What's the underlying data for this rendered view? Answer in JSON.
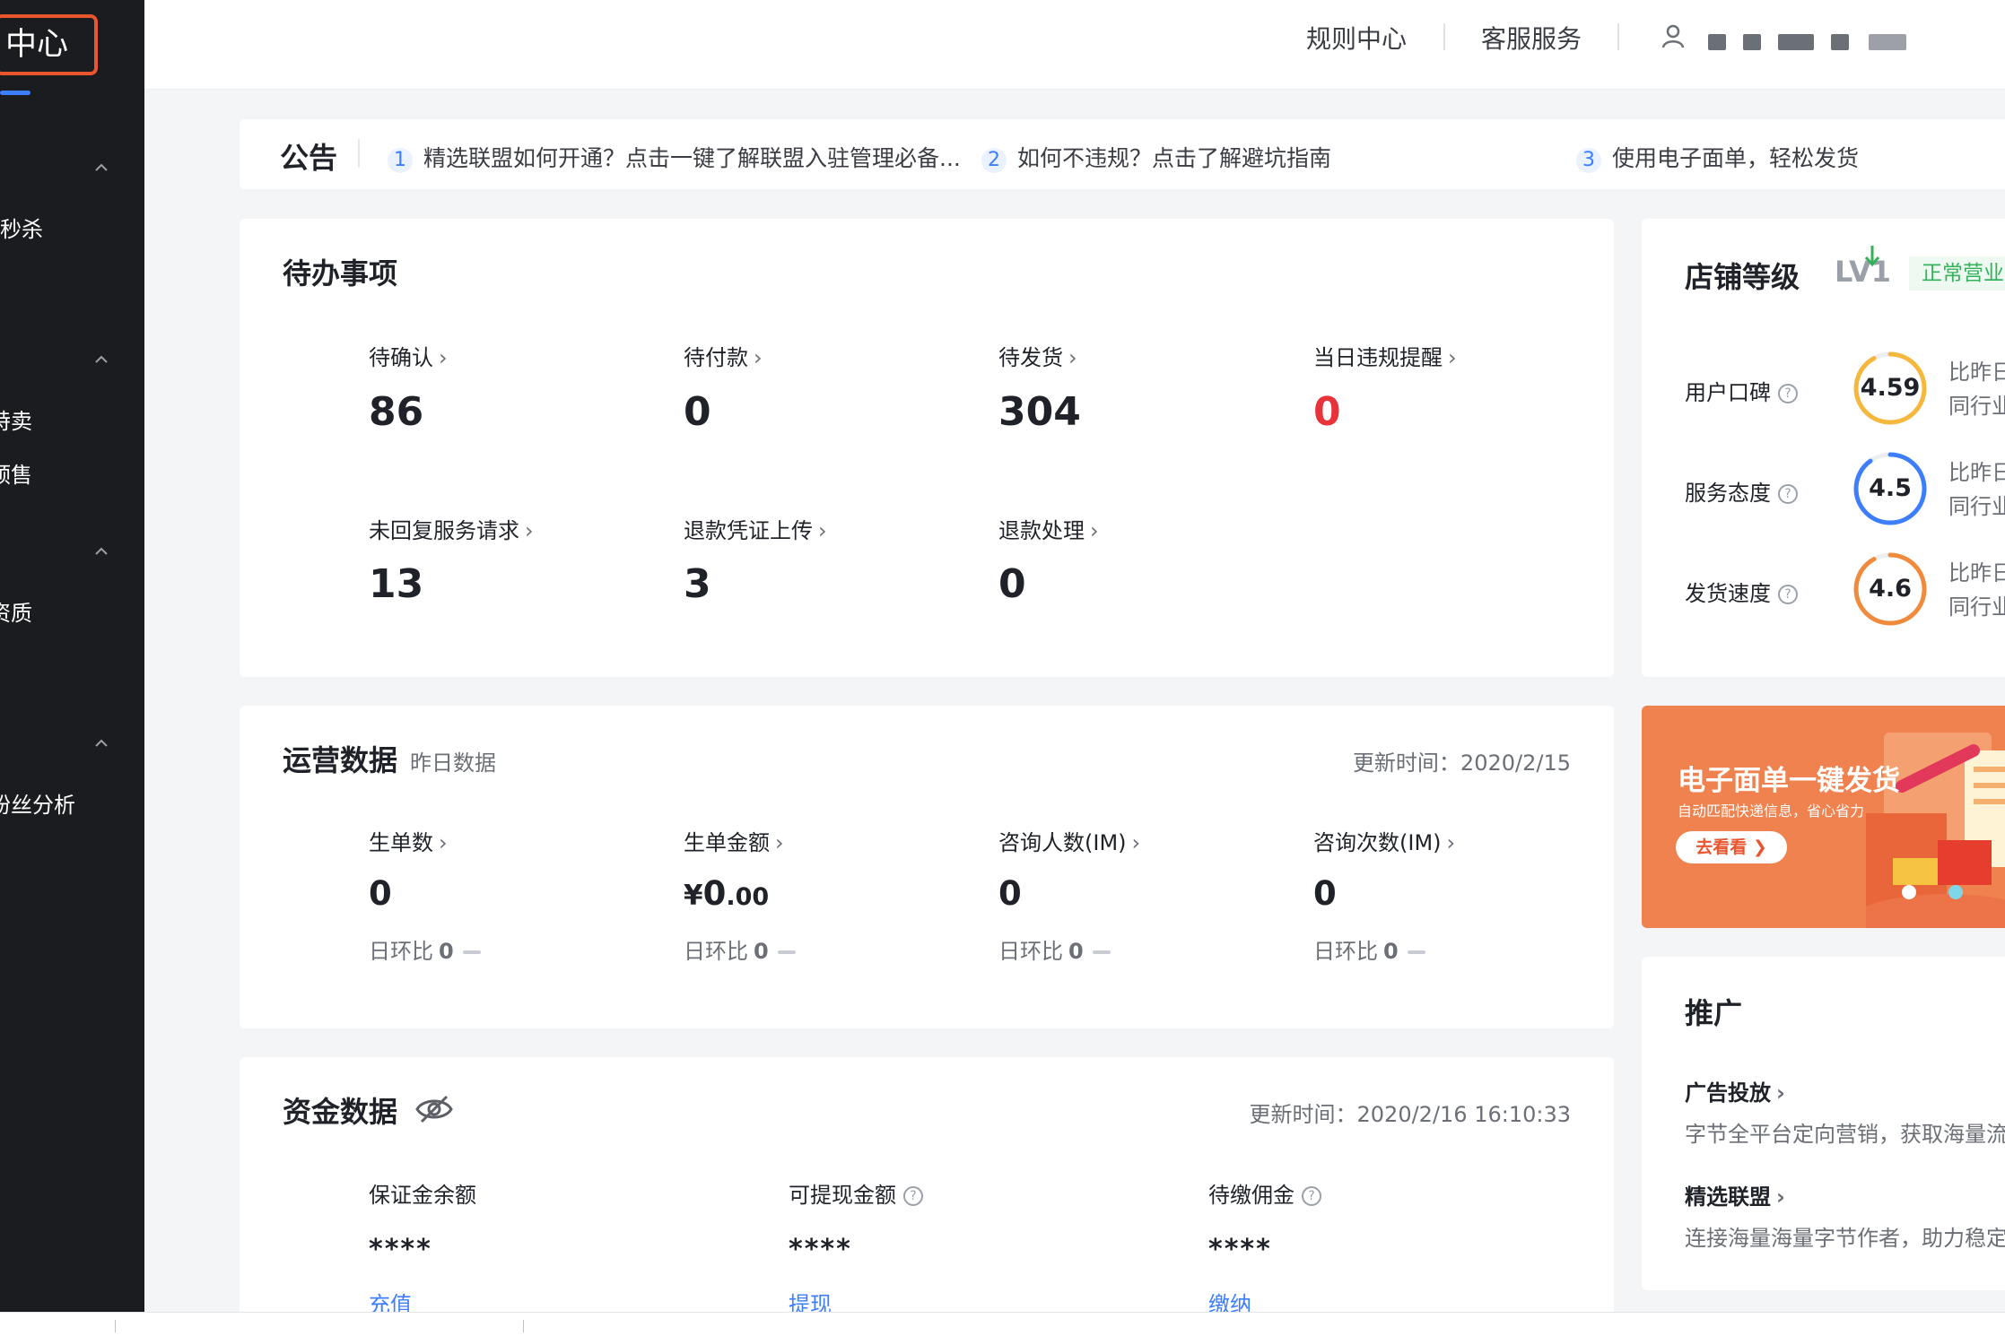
{
  "sidebar": {
    "brand": "中心",
    "items": [
      {
        "label": "秒杀"
      },
      {
        "label": "特卖"
      },
      {
        "label": "预售"
      },
      {
        "label": "资质"
      },
      {
        "label": "粉丝分析"
      }
    ]
  },
  "header": {
    "links": [
      "规则中心",
      "客服服务"
    ]
  },
  "notice": {
    "title": "公告",
    "items": [
      {
        "num": "1",
        "text": "精选联盟如何开通？点击一键了解联盟入驻管理必备..."
      },
      {
        "num": "2",
        "text": "如何不违规？点击了解避坑指南"
      },
      {
        "num": "3",
        "text": "使用电子面单，轻松发货"
      }
    ]
  },
  "todo": {
    "title": "待办事项",
    "items": [
      {
        "label": "待确认",
        "value": "86"
      },
      {
        "label": "待付款",
        "value": "0"
      },
      {
        "label": "待发货",
        "value": "304"
      },
      {
        "label": "当日违规提醒",
        "value": "0"
      },
      {
        "label": "未回复服务请求",
        "value": "13"
      },
      {
        "label": "退款凭证上传",
        "value": "3"
      },
      {
        "label": "退款处理",
        "value": "0"
      }
    ]
  },
  "shop": {
    "title": "店铺等级",
    "level": "LV1",
    "status": "正常营业",
    "ratings": [
      {
        "label": "用户口碑",
        "value": "4.59",
        "fraction": 0.92,
        "color": "#f5b83d",
        "cmp1": "比昨日",
        "cmp2": "同行业"
      },
      {
        "label": "服务态度",
        "value": "4.5",
        "fraction": 0.9,
        "color": "#3d7eff",
        "cmp1": "比昨日",
        "cmp2": "同行业"
      },
      {
        "label": "发货速度",
        "value": "4.6",
        "fraction": 0.92,
        "color": "#f08a3c",
        "cmp1": "比昨日",
        "cmp2": "同行业"
      }
    ]
  },
  "ops": {
    "title": "运营数据",
    "subtitle": "昨日数据",
    "update_label": "更新时间：2020/2/15",
    "ratio_label": "日环比",
    "items": [
      {
        "label": "生单数",
        "value": "0",
        "ratio": "0"
      },
      {
        "label": "生单金额",
        "currency": "¥",
        "value": "0",
        "decimal": ".00",
        "ratio": "0"
      },
      {
        "label": "咨询人数(IM)",
        "value": "0",
        "ratio": "0"
      },
      {
        "label": "咨询次数(IM)",
        "value": "0",
        "ratio": "0"
      }
    ]
  },
  "banner": {
    "title": "电子面单一键发货",
    "subtitle": "自动匹配快递信息，省心省力",
    "button": "去看看 ❯"
  },
  "funds": {
    "title": "资金数据",
    "update_label": "更新时间：2020/2/16 16:10:33",
    "items": [
      {
        "label": "保证金余额",
        "value": "****",
        "action": "充值"
      },
      {
        "label": "可提现金额",
        "value": "****",
        "action": "提现"
      },
      {
        "label": "待缴佣金",
        "value": "****",
        "action": "缴纳"
      }
    ]
  },
  "promo": {
    "title": "推广",
    "items": [
      {
        "label": "广告投放",
        "desc": "字节全平台定向营销，获取海量流"
      },
      {
        "label": "精选联盟",
        "desc": "连接海量海量字节作者，助力稳定"
      }
    ]
  }
}
